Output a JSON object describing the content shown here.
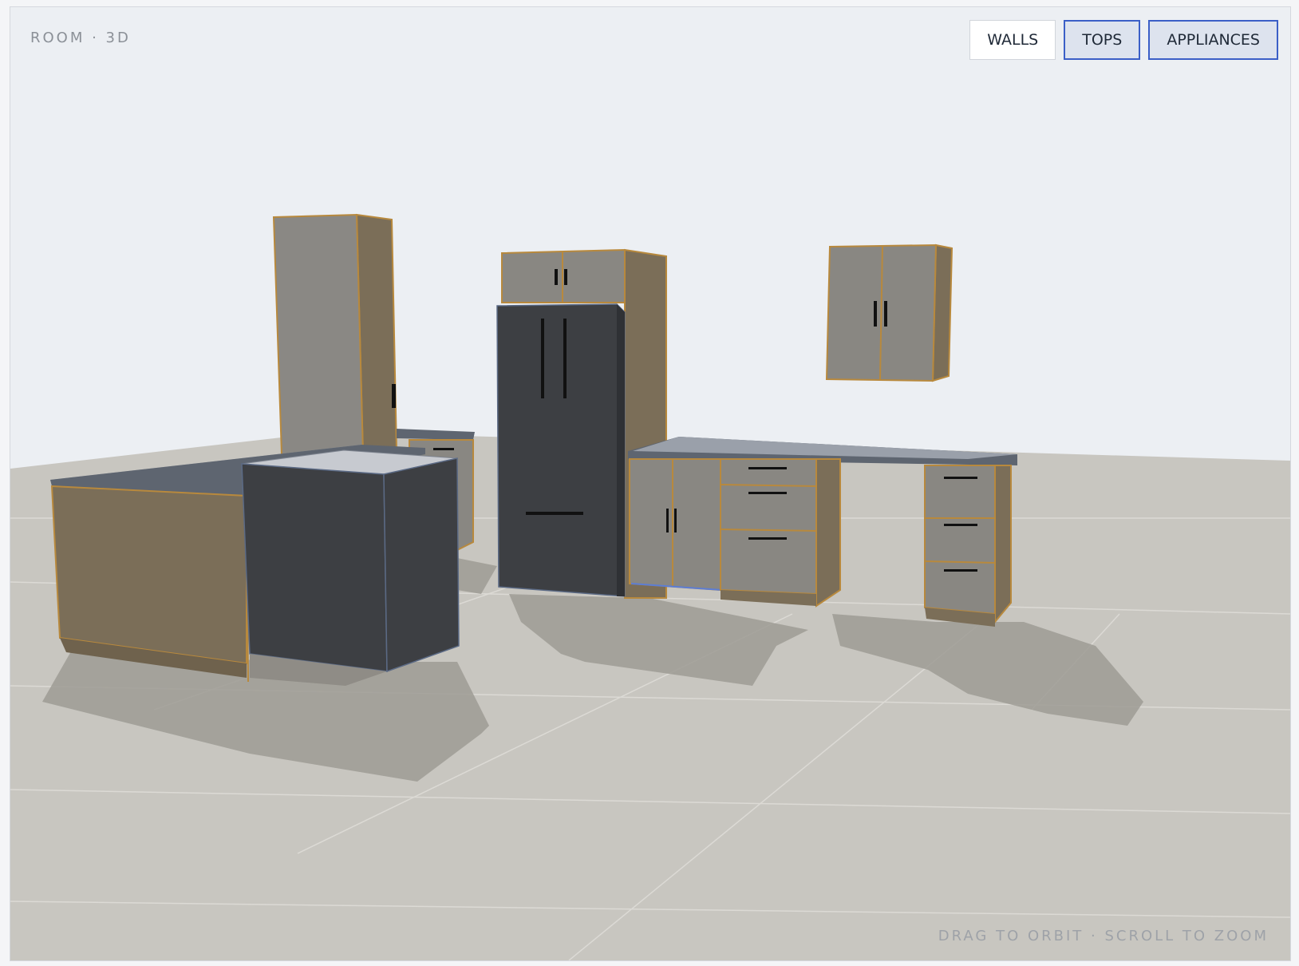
{
  "viewport": {
    "mode_label": "ROOM · 3D",
    "hint": "DRAG TO ORBIT · SCROLL TO ZOOM"
  },
  "toggles": [
    {
      "label": "WALLS",
      "active": false
    },
    {
      "label": "TOPS",
      "active": true
    },
    {
      "label": "APPLIANCES",
      "active": true
    }
  ],
  "colors": {
    "background_wall": "#eceff3",
    "floor": "#c8c6c0",
    "cabinet_side": "#7b6e58",
    "cabinet_front": "#898782",
    "countertop": "#5e6570",
    "appliance": "#3d3f43",
    "edge": "#b8893d",
    "accent": "#3b5fc7"
  }
}
